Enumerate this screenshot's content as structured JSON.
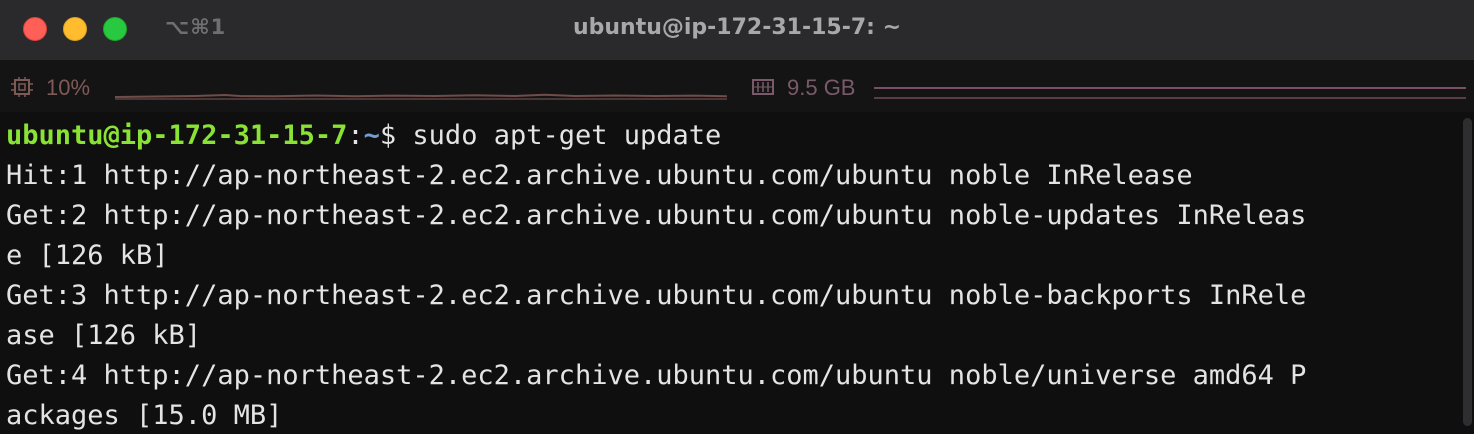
{
  "window": {
    "title": "ubuntu@ip-172-31-15-7: ~",
    "shortcut": "⌥⌘1",
    "colors": {
      "close": "#fe5f57",
      "minimize": "#febc2e",
      "zoom": "#28c840"
    }
  },
  "status": {
    "cpu": {
      "icon": "cpu-icon",
      "label": "10%",
      "color": "#7e5a57"
    },
    "memory": {
      "icon": "memory-icon",
      "label": "9.5 GB",
      "color": "#7a5a6a"
    }
  },
  "terminal": {
    "prompt": {
      "user_host": "ubuntu@ip-172-31-15-7",
      "separator": ":",
      "path": "~",
      "sign": "$ ",
      "command": "sudo apt-get update"
    },
    "output": [
      "Hit:1 http://ap-northeast-2.ec2.archive.ubuntu.com/ubuntu noble InRelease",
      "Get:2 http://ap-northeast-2.ec2.archive.ubuntu.com/ubuntu noble-updates InReleas",
      "e [126 kB]",
      "Get:3 http://ap-northeast-2.ec2.archive.ubuntu.com/ubuntu noble-backports InRele",
      "ase [126 kB]",
      "Get:4 http://ap-northeast-2.ec2.archive.ubuntu.com/ubuntu noble/universe amd64 P",
      "ackages [15.0 MB]"
    ]
  }
}
